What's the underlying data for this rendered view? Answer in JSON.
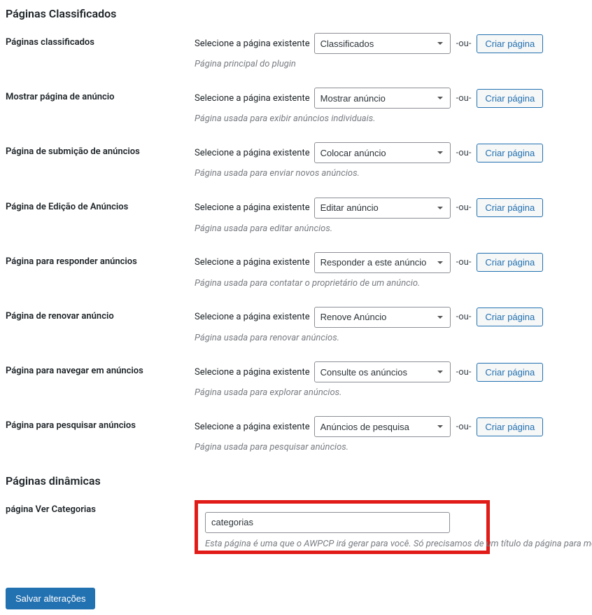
{
  "section1_title": "Páginas Classificados",
  "section2_title": "Páginas dinâmicas",
  "common": {
    "select_hint": "Selecione a página existente",
    "or": "-ou-",
    "create_button": "Criar página"
  },
  "rows": [
    {
      "label": "Páginas classificados",
      "selected": "Classificados",
      "description": "Página principal do plugin"
    },
    {
      "label": "Mostrar página de anúncio",
      "selected": "Mostrar anúncio",
      "description": "Página usada para exibir anúncios individuais."
    },
    {
      "label": "Página de submição de anúncios",
      "selected": "Colocar anúncio",
      "description": "Página usada para enviar novos anúncios."
    },
    {
      "label": "Página de Edição de Anúncios",
      "selected": "Editar anúncio",
      "description": "Página usada para editar anúncios."
    },
    {
      "label": "Página para responder anúncios",
      "selected": "Responder a este anúncio",
      "description": "Página usada para contatar o proprietário de um anúncio."
    },
    {
      "label": "Página de renovar anúncio",
      "selected": "Renove Anúncio",
      "description": "Página usada para renovar anúncios."
    },
    {
      "label": "Página para navegar em anúncios",
      "selected": "Consulte os anúncios",
      "description": "Página usada para explorar anúncios."
    },
    {
      "label": "Página para pesquisar anúncios",
      "selected": "Anúncios de pesquisa",
      "description": "Página usada para pesquisar anúncios."
    }
  ],
  "dynamic": {
    "label": "página Ver Categorias",
    "value": "categorias",
    "description": "Esta página é uma que o AWPCP irá gerar para você. Só precisamos de um título da página para mos"
  },
  "save_button": "Salvar alterações"
}
